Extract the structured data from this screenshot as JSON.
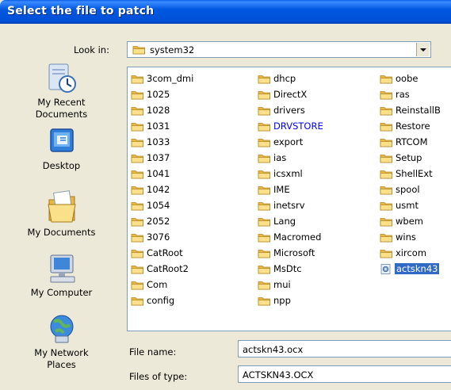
{
  "dialog": {
    "title": "Select the file to patch"
  },
  "look_in": {
    "label": "Look in:",
    "value": "system32",
    "icon": "folder-icon"
  },
  "places": [
    {
      "label_line1": "My Recent",
      "label_line2": "Documents",
      "icon": "recent-documents-icon"
    },
    {
      "label_line1": "Desktop",
      "label_line2": "",
      "icon": "desktop-icon"
    },
    {
      "label_line1": "My Documents",
      "label_line2": "",
      "icon": "my-documents-icon"
    },
    {
      "label_line1": "My Computer",
      "label_line2": "",
      "icon": "my-computer-icon"
    },
    {
      "label_line1": "My Network",
      "label_line2": "Places",
      "icon": "network-places-icon"
    }
  ],
  "files": {
    "col1": [
      "3com_dmi",
      "1025",
      "1028",
      "1031",
      "1033",
      "1037",
      "1041",
      "1042",
      "1054",
      "2052",
      "3076",
      "CatRoot",
      "CatRoot2",
      "Com",
      "config"
    ],
    "col2": [
      "dhcp",
      "DirectX",
      "drivers",
      "DRVSTORE",
      "export",
      "ias",
      "icsxml",
      "IME",
      "inetsrv",
      "Lang",
      "Macromed",
      "Microsoft",
      "MsDtc",
      "mui",
      "npp"
    ],
    "col3": [
      "oobe",
      "ras",
      "ReinstallB",
      "Restore",
      "RTCOM",
      "Setup",
      "ShellExt",
      "spool",
      "usmt",
      "wbem",
      "wins",
      "xircom",
      "actskn43"
    ],
    "highlighted_folder": "DRVSTORE",
    "selected_file": "actskn43"
  },
  "file_name": {
    "label": "File name:",
    "value": "actskn43.ocx"
  },
  "files_of_type": {
    "label": "Files of type:",
    "value": "ACTSKN43.OCX"
  },
  "colors": {
    "title_bar": "#0058e0",
    "selection": "#316ac5",
    "folder": "#f4d36b"
  }
}
